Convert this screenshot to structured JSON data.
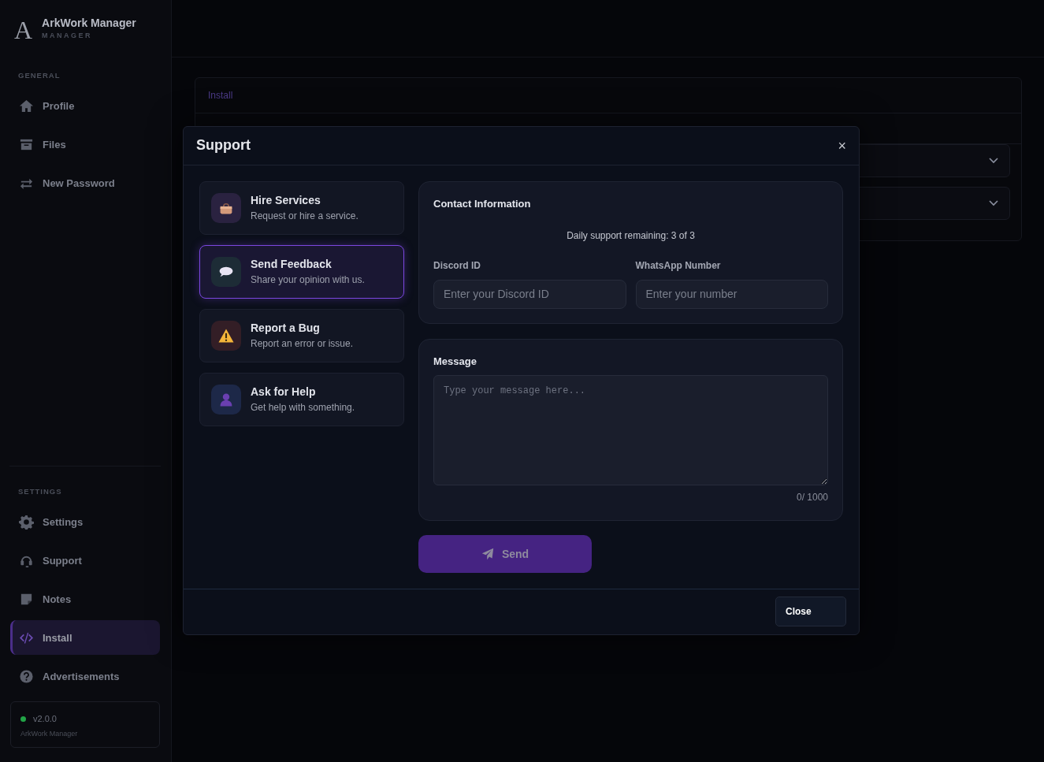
{
  "brand": {
    "logo": "A",
    "name": "ArkWork Manager",
    "subtitle": "MANAGER"
  },
  "sidebar": {
    "sections": [
      {
        "heading": "GENERAL",
        "items": [
          {
            "label": "Profile",
            "selected": false
          },
          {
            "label": "Files",
            "selected": false
          },
          {
            "label": "New Password",
            "selected": false
          }
        ]
      },
      {
        "heading": "SETTINGS",
        "items": [
          {
            "label": "Settings",
            "selected": false
          },
          {
            "label": "Support",
            "selected": false
          },
          {
            "label": "Notes",
            "selected": false
          },
          {
            "label": "Install",
            "selected": true
          },
          {
            "label": "Advertisements",
            "selected": false
          }
        ]
      }
    ],
    "version": {
      "label": "v2.0.0",
      "color": "#22a447",
      "caption": "ArkWork Manager"
    }
  },
  "background_panel": {
    "tab": "Install",
    "accordions": [
      {
        "expanded": false
      },
      {
        "expanded": false
      }
    ]
  },
  "modal": {
    "title": "Support",
    "close_icon": "×",
    "options": [
      {
        "title": "Hire Services",
        "description": "Request or hire a service.",
        "selected": false
      },
      {
        "title": "Send Feedback",
        "description": "Share your opinion with us.",
        "selected": true
      },
      {
        "title": "Report a Bug",
        "description": "Report an error or issue.",
        "selected": false
      },
      {
        "title": "Ask for Help",
        "description": "Get help with something.",
        "selected": false
      }
    ],
    "contact": {
      "heading": "Contact Information",
      "remaining": "Daily support remaining: 3 of 3",
      "fields": [
        {
          "label": "Discord ID",
          "placeholder": "Enter your Discord ID"
        },
        {
          "label": "WhatsApp Number",
          "placeholder": "Enter your number"
        }
      ]
    },
    "message": {
      "heading": "Message",
      "placeholder": "Type your message here...",
      "counter": "0/ 1000"
    },
    "send_button": {
      "label": "Send",
      "disabled": true
    },
    "close_button": "Close"
  }
}
